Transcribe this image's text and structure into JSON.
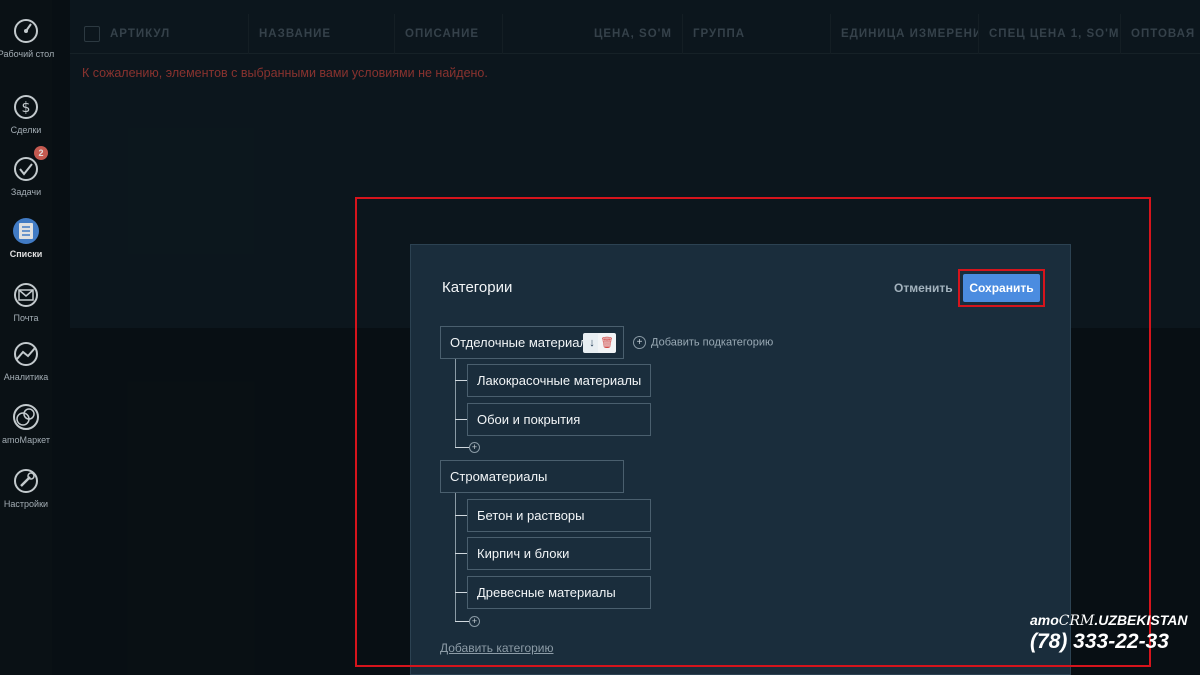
{
  "sidebar": {
    "items": [
      {
        "label": "Рабочий стол",
        "icon": "dashboard-gauge-icon"
      },
      {
        "label": "Сделки",
        "icon": "dollar-icon"
      },
      {
        "label": "Задачи",
        "icon": "check-circle-icon",
        "badge": "2"
      },
      {
        "label": "Списки",
        "icon": "lists-icon",
        "active": true
      },
      {
        "label": "Почта",
        "icon": "mail-icon"
      },
      {
        "label": "Аналитика",
        "icon": "analytics-icon"
      },
      {
        "label": "amoМаркет",
        "icon": "market-icon"
      },
      {
        "label": "Настройки",
        "icon": "wrench-icon"
      }
    ]
  },
  "table": {
    "columns": [
      "АРТИКУЛ",
      "НАЗВАНИЕ",
      "ОПИСАНИЕ",
      "ЦЕНА, SO'M",
      "ГРУППА",
      "ЕДИНИЦА ИЗМЕРЕНИ",
      "СПЕЦ ЦЕНА 1, SO'M",
      "ОПТОВАЯ ЦЕ"
    ],
    "empty_message": "К сожалению, элементов с выбранными вами условиями не найдено."
  },
  "modal": {
    "title": "Категории",
    "cancel_label": "Отменить",
    "save_label": "Сохранить",
    "add_subcategory_label": "Добавить подкатегорию",
    "add_category_label": "Добавить категорию",
    "categories": [
      {
        "name": "Отделочные материалы",
        "children": [
          "Лакокрасочные материалы",
          "Обои и покрытия"
        ]
      },
      {
        "name": "Строматериалы",
        "children": [
          "Бетон и растворы",
          "Кирпич и блоки",
          "Древесные материалы"
        ]
      }
    ],
    "tool_down": "↓",
    "tool_trash": "🗑",
    "plus": "+"
  },
  "brand": {
    "amo": "amo",
    "crm": "CRM",
    "suffix": ".UZBEKISTAN",
    "phone": "(78) 333-22-33"
  },
  "colors": {
    "accent": "#4b8ce0",
    "highlight": "#d6141c",
    "badge": "#e0675c",
    "error_text": "#9c3a36"
  }
}
